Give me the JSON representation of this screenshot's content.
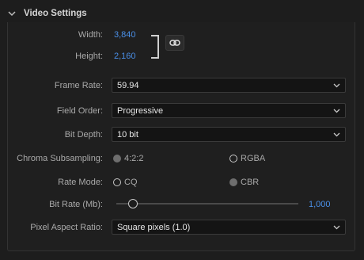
{
  "section": {
    "title": "Video Settings"
  },
  "dimensions": {
    "width_label": "Width:",
    "width_value": "3,840",
    "height_label": "Height:",
    "height_value": "2,160"
  },
  "frame_rate": {
    "label": "Frame Rate:",
    "value": "59.94"
  },
  "field_order": {
    "label": "Field Order:",
    "value": "Progressive"
  },
  "bit_depth": {
    "label": "Bit Depth:",
    "value": "10 bit"
  },
  "chroma": {
    "label": "Chroma Subsampling:",
    "options": [
      {
        "label": "4:2:2",
        "selected": false,
        "enabled": false
      },
      {
        "label": "RGBA",
        "selected": false,
        "enabled": true
      }
    ]
  },
  "rate_mode": {
    "label": "Rate Mode:",
    "options": [
      {
        "label": "CQ",
        "selected": false,
        "enabled": true
      },
      {
        "label": "CBR",
        "selected": false,
        "enabled": false
      }
    ]
  },
  "bit_rate": {
    "label": "Bit Rate (Mb):",
    "value": "1,000",
    "slider_fraction": 0.09
  },
  "pixel_aspect": {
    "label": "Pixel Aspect Ratio:",
    "value": "Square pixels (1.0)"
  },
  "colors": {
    "accent": "#4a8fe7",
    "background": "#1d1d1d",
    "field_bg": "#141414"
  },
  "icons": {
    "collapse": "chevron-down-icon",
    "link": "link-icon",
    "dropdown": "caret-down-icon"
  }
}
